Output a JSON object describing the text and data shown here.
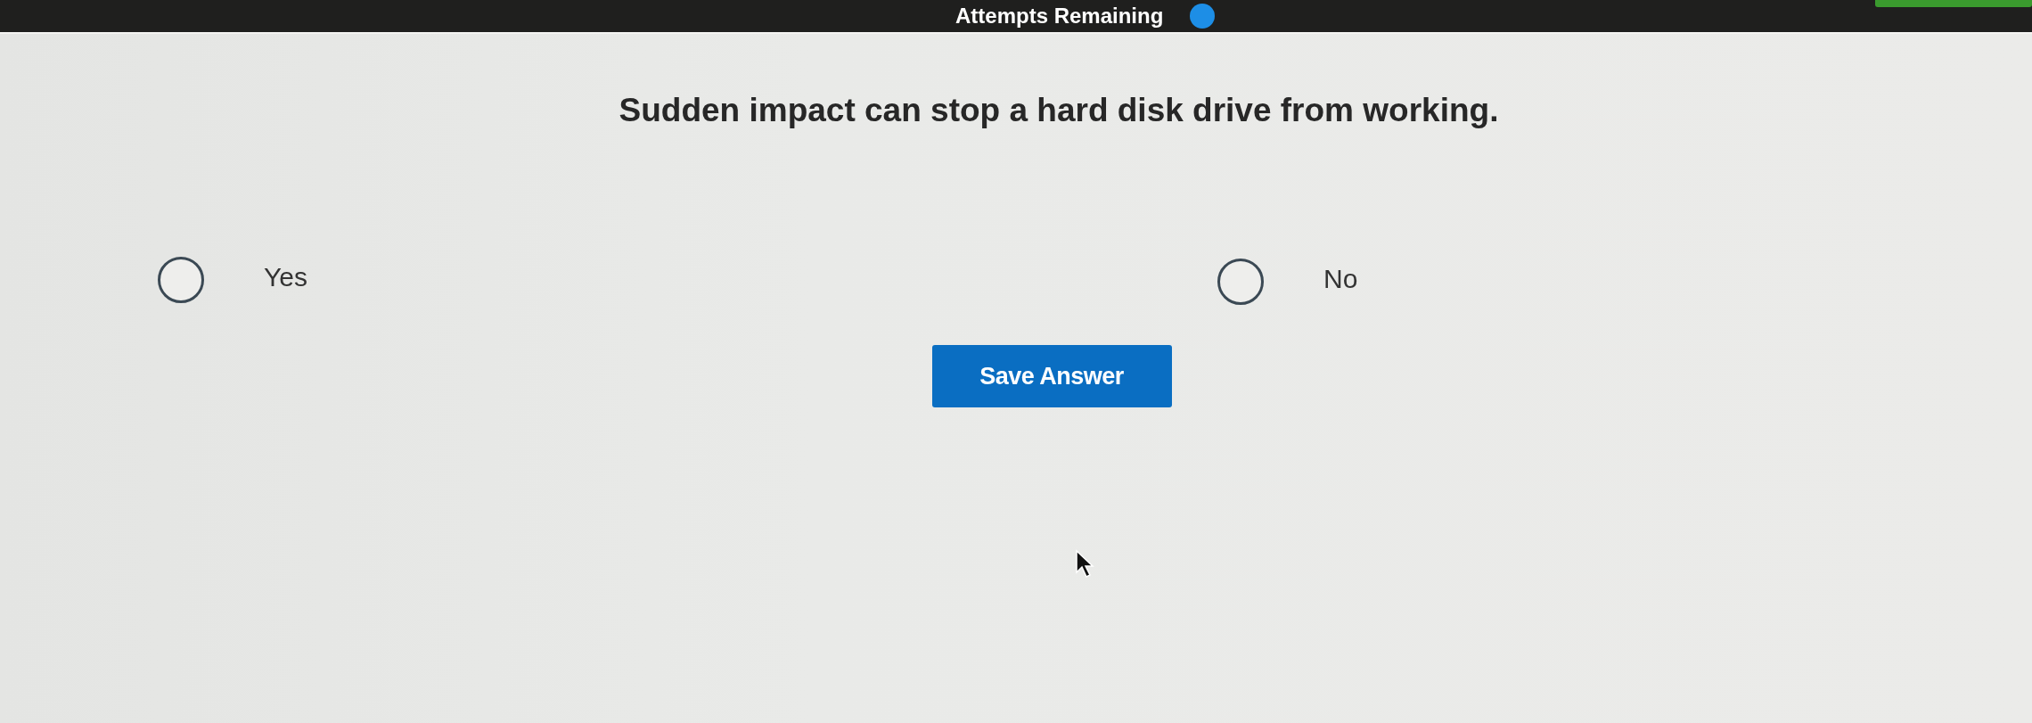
{
  "header": {
    "title": "Attempts Remaining"
  },
  "question": {
    "prompt": "Sudden impact can stop a hard disk drive from working.",
    "options": [
      {
        "label": "Yes",
        "selected": false
      },
      {
        "label": "No",
        "selected": false
      }
    ],
    "submit": "Save Answer"
  }
}
